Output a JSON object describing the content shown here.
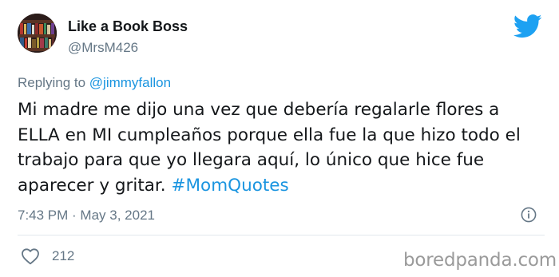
{
  "author": {
    "name": "Like a Book Boss",
    "handle": "@MrsM426"
  },
  "reply": {
    "prefix": "Replying to ",
    "mention": "@jimmyfallon"
  },
  "tweet": {
    "text": "Mi madre me dijo una vez que debería regalarle flores a ELLA en MI cumpleaños porque ella fue la que hizo todo el trabajo para que yo llegara aquí, lo único que hice fue aparecer y gritar.  ",
    "hashtag": "#MomQuotes"
  },
  "meta": {
    "timestamp": "7:43 PM · May 3, 2021"
  },
  "engagement": {
    "likes": "212"
  },
  "watermark": "boredpanda.com",
  "icons": {
    "brand": "twitter-bird-icon",
    "info": "info-icon",
    "like": "heart-icon"
  },
  "colors": {
    "accent": "#1b95e0",
    "muted": "#657786",
    "text": "#14171a",
    "twitter_blue": "#1da1f2"
  }
}
